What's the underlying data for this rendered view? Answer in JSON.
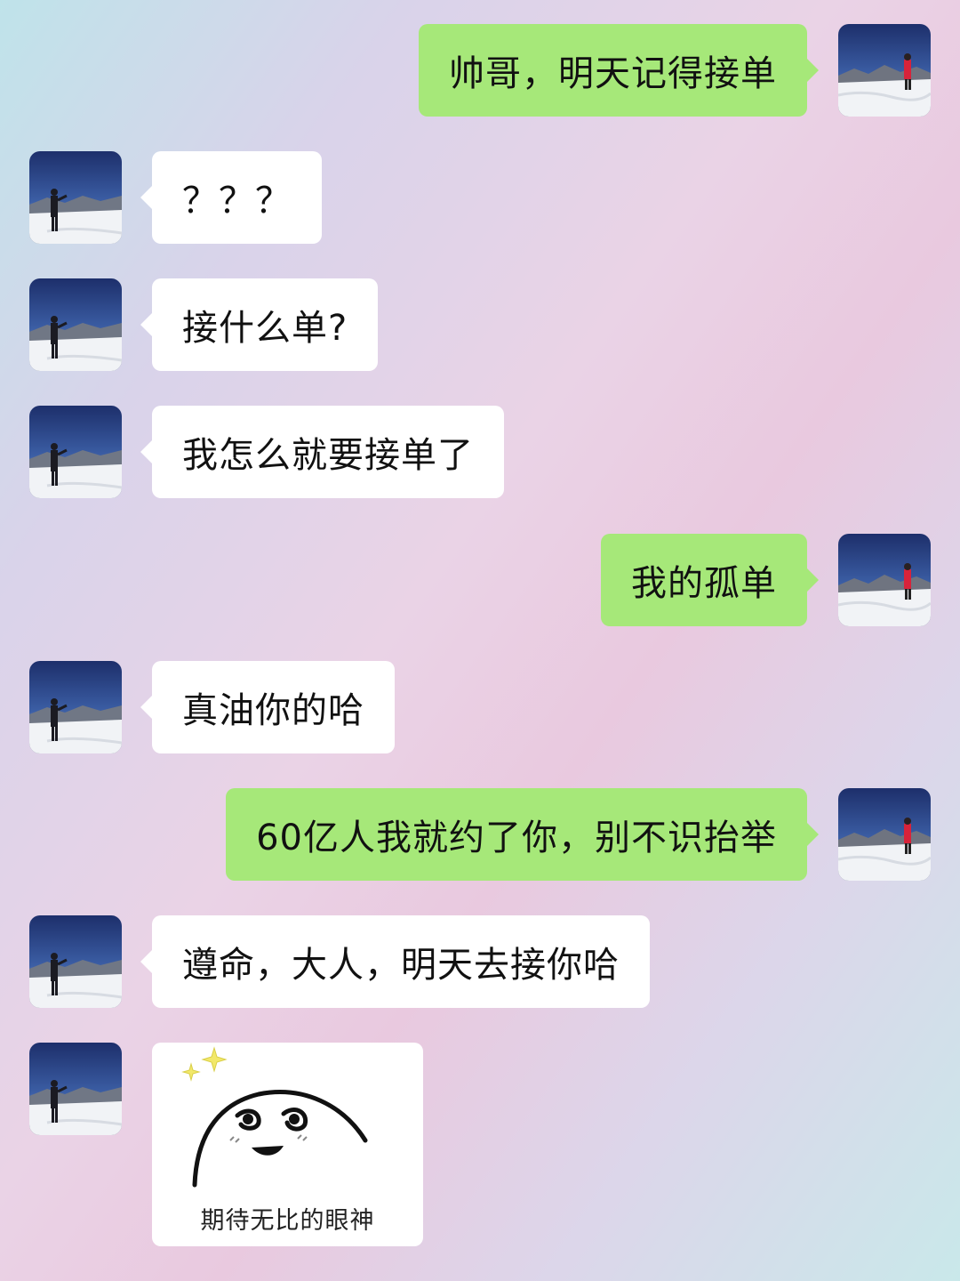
{
  "messages": [
    {
      "side": "right",
      "text": "帅哥，明天记得接单"
    },
    {
      "side": "left",
      "text": "？？？"
    },
    {
      "side": "left",
      "text": "接什么单?"
    },
    {
      "side": "left",
      "text": "我怎么就要接单了"
    },
    {
      "side": "right",
      "text": "我的孤单"
    },
    {
      "side": "left",
      "text": "真油你的哈"
    },
    {
      "side": "right",
      "text": "60亿人我就约了你，别不识抬举"
    },
    {
      "side": "left",
      "text": "遵命，大人，明天去接你哈"
    },
    {
      "side": "left",
      "type": "sticker",
      "caption": "期待无比的眼神"
    }
  ],
  "avatars": {
    "self": "avatar-photo-person-in-red-on-snow",
    "friend": "avatar-photo-person-in-dark-on-snow"
  },
  "colors": {
    "self_bubble": "#a6e879",
    "friend_bubble": "#ffffff",
    "sky": "#2e4a8c",
    "snow": "#f2f4f7"
  }
}
